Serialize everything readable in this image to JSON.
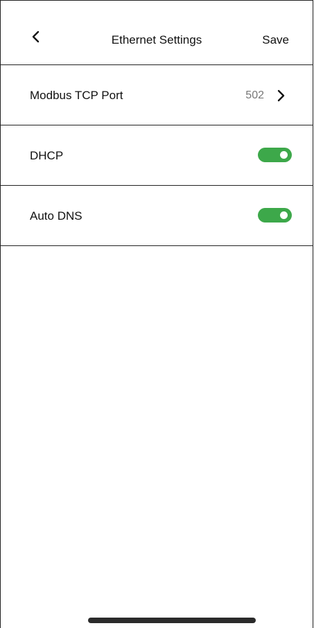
{
  "header": {
    "title": "Ethernet Settings",
    "save_label": "Save",
    "back_icon": "chevron-left-icon"
  },
  "rows": [
    {
      "label": "Modbus TCP Port",
      "value": "502",
      "type": "link",
      "icon": "chevron-right-icon"
    },
    {
      "label": "DHCP",
      "type": "toggle",
      "enabled": true
    },
    {
      "label": "Auto DNS",
      "type": "toggle",
      "enabled": true
    }
  ],
  "colors": {
    "toggle_on": "#3da84a",
    "divider": "#222222",
    "value_text": "#777777"
  }
}
